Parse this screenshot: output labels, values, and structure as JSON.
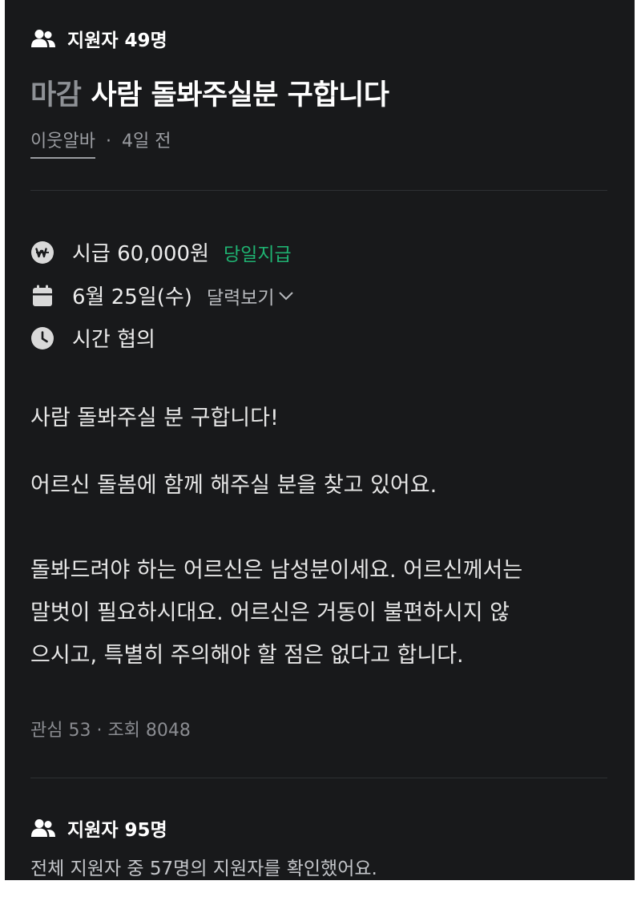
{
  "header": {
    "applicants_label": "지원자 49명",
    "status_badge": "마감",
    "title": "사람 돌봐주실분 구합니다",
    "author": "이웃알바",
    "separator": "·",
    "posted_ago": "4일 전"
  },
  "details": {
    "wage": "시급 60,000원",
    "pay_badge": "당일지급",
    "date": "6월 25일(수)",
    "calendar_link": "달력보기",
    "time": "시간 협의"
  },
  "description": {
    "lines": [
      "사람 돌봐주실 분 구합니다!",
      "",
      "어르신 돌봄에 함께 해주실 분을 찾고 있어요.",
      "",
      "돌봐드려야 하는 어르신은 남성분이세요. 어르신께서는",
      "말벗이 필요하시대요. 어르신은 거동이 불편하시지 않",
      "으시고, 특별히 주의해야 할 점은 없다고 합니다."
    ]
  },
  "stats": {
    "text": "관심 53 · 조회 8048"
  },
  "applicants_section": {
    "label": "지원자 95명",
    "confirmed_text": "전체 지원자 중 57명의 지원자를 확인했어요."
  },
  "colors": {
    "background": "#18191b",
    "accent_green": "#1fb171",
    "muted_text": "#9a9ca1"
  },
  "icons": [
    "people-icon",
    "won-coin-icon",
    "calendar-icon",
    "clock-icon",
    "chevron-down-icon"
  ]
}
